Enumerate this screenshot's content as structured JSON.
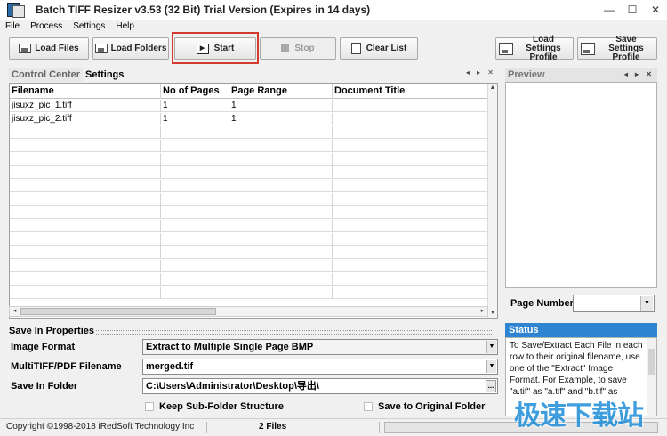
{
  "window": {
    "title": "Batch TIFF Resizer v3.53 (32 Bit)  Trial Version (Expires in 14 days)",
    "minimize": "—",
    "maximize": "☐",
    "close": "✕"
  },
  "menu": [
    "File",
    "Process",
    "Settings",
    "Help"
  ],
  "toolbar": {
    "load_files": "Load Files",
    "load_folders": "Load Folders",
    "start": "Start",
    "stop": "Stop",
    "clear_list": "Clear List",
    "load_profile": "Load Settings Profile",
    "save_profile": "Save Settings Profile",
    "start_highlight_color": "#d23a2e"
  },
  "tabs": {
    "control_center": "Control Center",
    "settings": "Settings"
  },
  "grid": {
    "columns": [
      "Filename",
      "No of Pages",
      "Page Range",
      "Document Title"
    ],
    "rows": [
      {
        "filename": "jisuxz_pic_1.tiff",
        "pages": "1",
        "range": "1",
        "title": ""
      },
      {
        "filename": "jisuxz_pic_2.tiff",
        "pages": "1",
        "range": "1",
        "title": ""
      }
    ]
  },
  "preview": {
    "title": "Preview",
    "page_number_label": "Page Number"
  },
  "status": {
    "title": "Status",
    "text": "To Save/Extract Each File in each row to their original filename, use one of the \"Extract\" Image Format. For Example, to save \"a.tif\" as \"a.tif\" and \"b.tif\" as",
    "accent": "#2f84d2"
  },
  "save_props": {
    "title": "Save In Properties",
    "image_format_label": "Image Format",
    "image_format_value": "Extract to Multiple Single Page BMP",
    "multitiff_label": "MultiTIFF/PDF Filename",
    "multitiff_value": "merged.tif",
    "save_folder_label": "Save In Folder",
    "save_folder_value": "C:\\Users\\Administrator\\Desktop\\导出\\",
    "browse": "...",
    "keep_subfolder": "Keep Sub-Folder Structure",
    "save_original": "Save to Original Folder"
  },
  "statusbar": {
    "copyright": "Copyright ©1998-2018 iRedSoft Technology Inc",
    "files": "2 Files"
  },
  "watermark": "极速下载站"
}
